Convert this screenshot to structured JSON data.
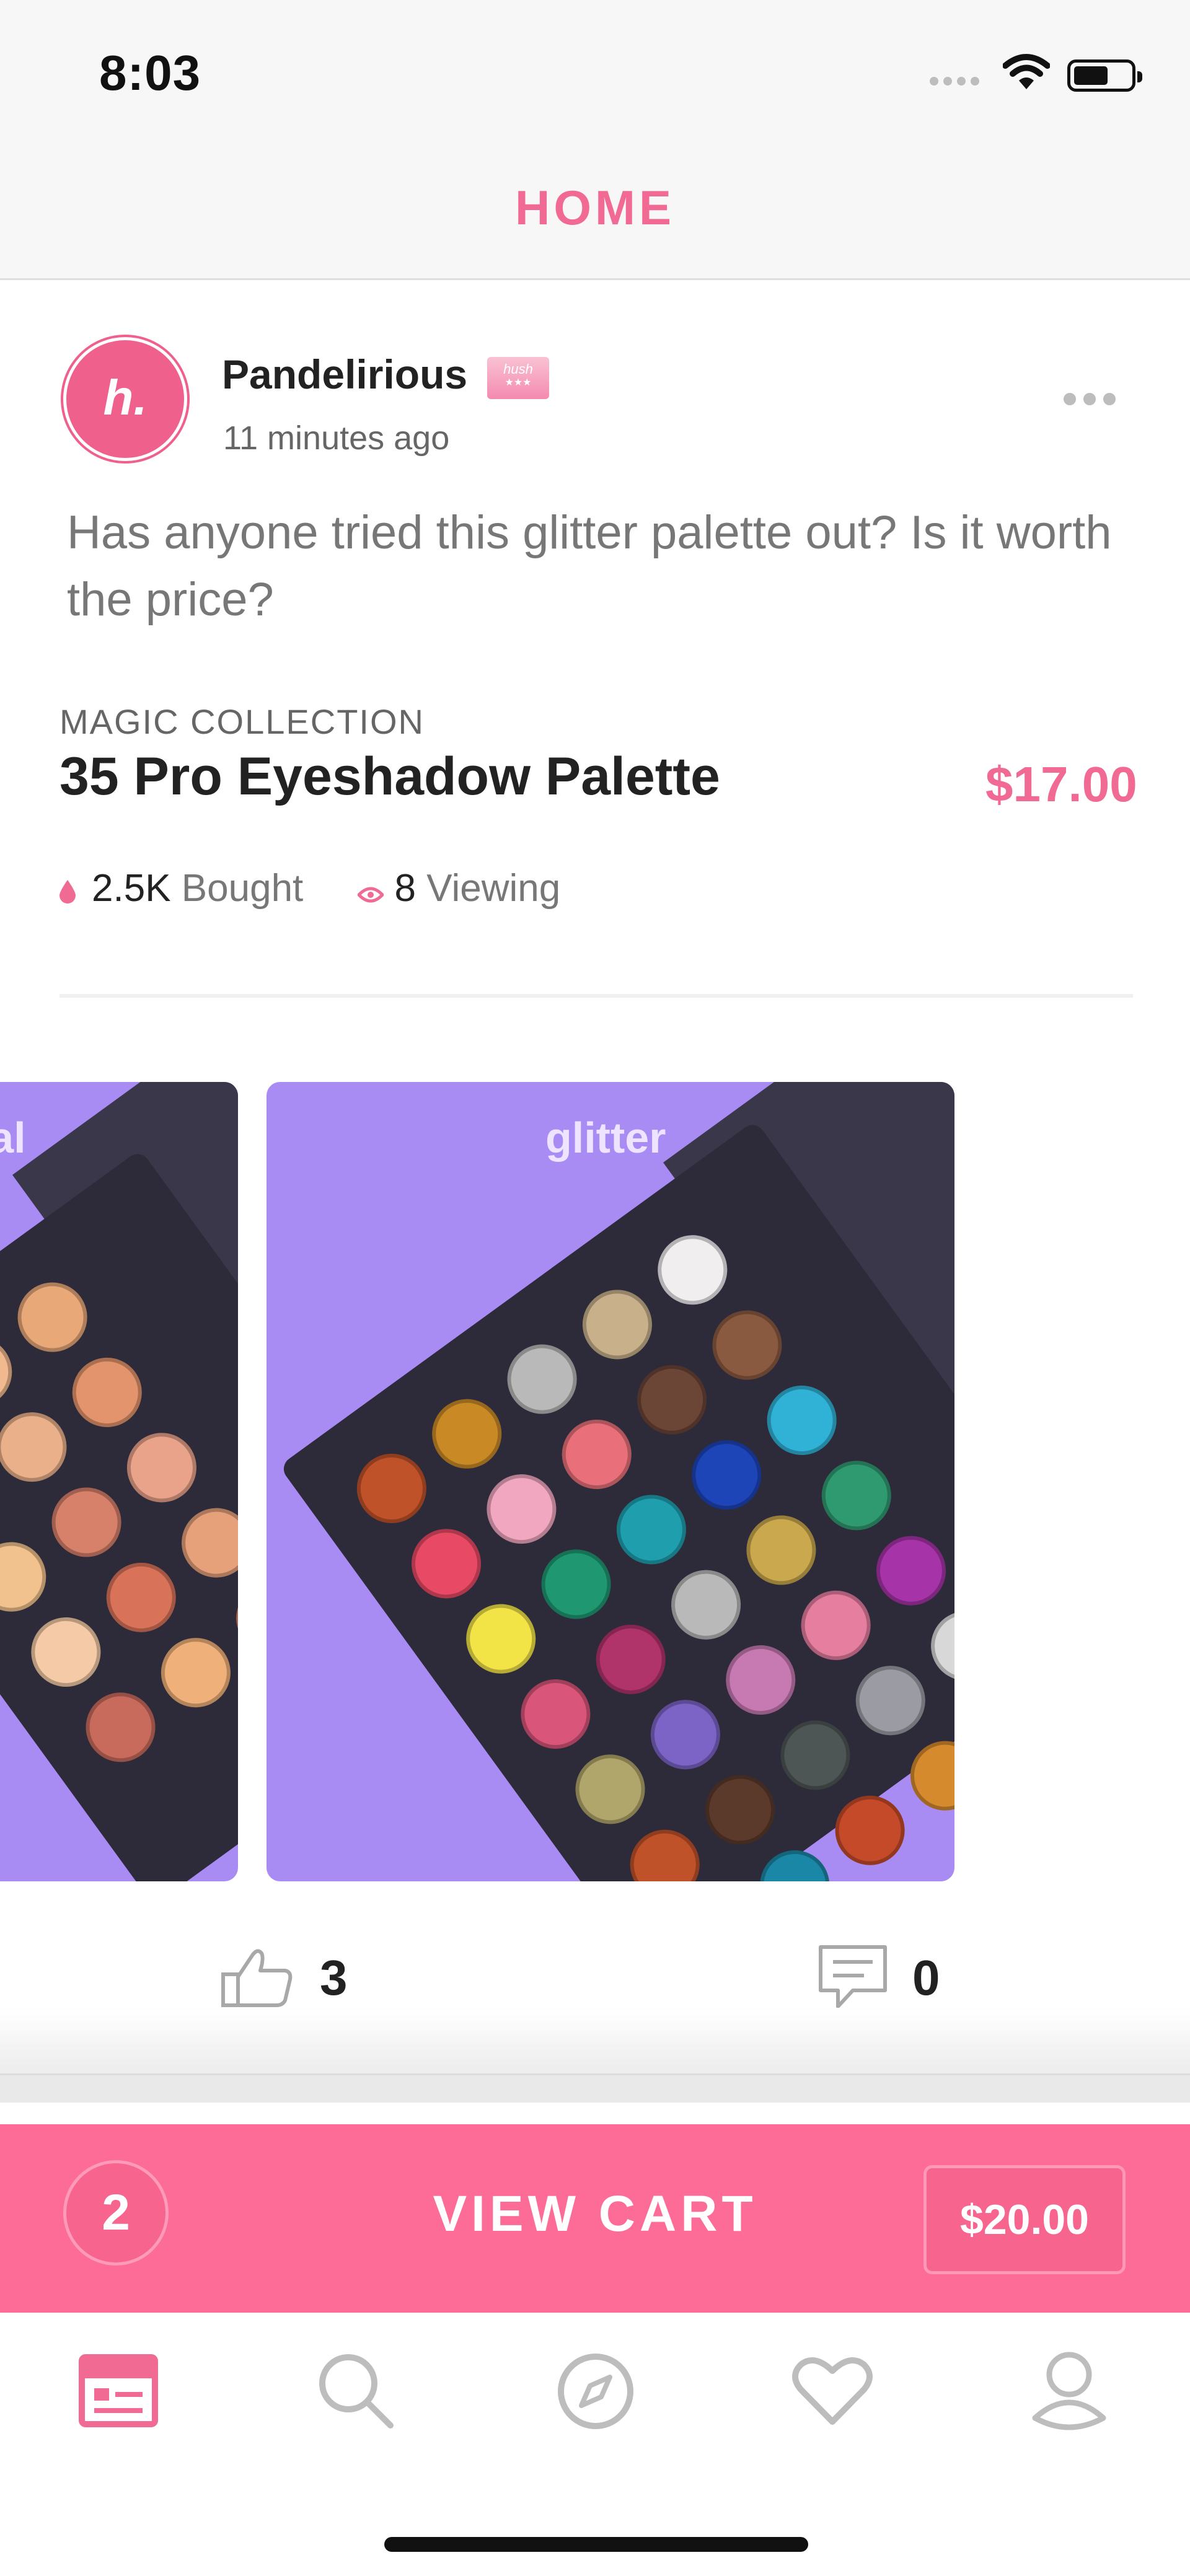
{
  "status_bar": {
    "time": "8:03"
  },
  "header": {
    "title": "HOME"
  },
  "post": {
    "avatar_letter": "h.",
    "author": "Pandelirious",
    "badge_text": "hush",
    "timestamp": "11 minutes ago",
    "text": "Has anyone tried this glitter palette out? Is it worth the price?",
    "product": {
      "collection": "MAGIC COLLECTION",
      "title": "35 Pro Eyeshadow Palette",
      "price": "$17.00",
      "bought_count": "2.5K",
      "bought_label": "Bought",
      "viewing_count": "8",
      "viewing_label": "Viewing"
    },
    "carousel": {
      "slides": [
        {
          "label": "ral"
        },
        {
          "label": "glitter"
        }
      ]
    },
    "likes": "3",
    "comments": "0"
  },
  "cart_bar": {
    "item_count": "2",
    "label": "VIEW CART",
    "total": "$20.00"
  },
  "tab_bar": {
    "items": [
      {
        "icon": "feed-icon",
        "active": true
      },
      {
        "icon": "search-icon",
        "active": false
      },
      {
        "icon": "compass-icon",
        "active": false
      },
      {
        "icon": "heart-icon",
        "active": false
      },
      {
        "icon": "profile-icon",
        "active": false
      }
    ]
  },
  "colors": {
    "brand_pink": "#f06a93",
    "cart_bar": "#fd6c96",
    "palette_background": "#a98bf4"
  }
}
